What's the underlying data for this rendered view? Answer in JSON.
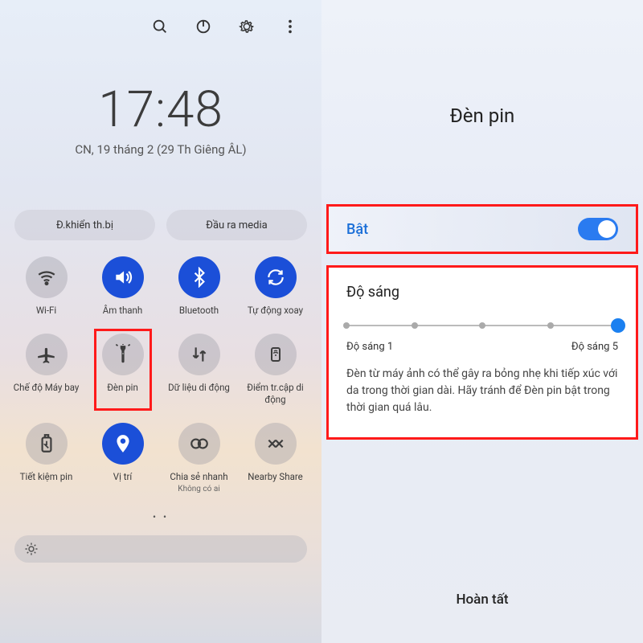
{
  "left": {
    "time": "17:48",
    "date": "CN, 19 tháng 2 (29 Th Giêng ÂL)",
    "chip1": "Đ.khiển th.bị",
    "chip2": "Đầu ra media",
    "tiles": [
      {
        "label": "Wi-Fi",
        "sub": "",
        "on": false,
        "icon": "wifi"
      },
      {
        "label": "Âm thanh",
        "sub": "",
        "on": true,
        "icon": "sound"
      },
      {
        "label": "Bluetooth",
        "sub": "",
        "on": true,
        "icon": "bluetooth"
      },
      {
        "label": "Tự động xoay",
        "sub": "",
        "on": true,
        "icon": "rotate"
      },
      {
        "label": "Chế độ Máy bay",
        "sub": "",
        "on": false,
        "icon": "airplane"
      },
      {
        "label": "Đèn pin",
        "sub": "",
        "on": false,
        "icon": "flashlight",
        "highlight": true
      },
      {
        "label": "Dữ liệu di động",
        "sub": "",
        "on": false,
        "icon": "data"
      },
      {
        "label": "Điểm tr.cập di động",
        "sub": "",
        "on": false,
        "icon": "hotspot"
      },
      {
        "label": "Tiết kiệm pin",
        "sub": "",
        "on": false,
        "icon": "battery"
      },
      {
        "label": "Vị trí",
        "sub": "",
        "on": true,
        "icon": "location"
      },
      {
        "label": "Chia sẻ nhanh",
        "sub": "Không có ai",
        "on": false,
        "icon": "quickshare"
      },
      {
        "label": "Nearby Share",
        "sub": "",
        "on": false,
        "icon": "nearby"
      }
    ],
    "pager": "• •"
  },
  "right": {
    "title": "Đèn pin",
    "toggle_label": "Bật",
    "toggle_on": true,
    "brightness_heading": "Độ sáng",
    "slider_min_label": "Độ sáng 1",
    "slider_max_label": "Độ sáng 5",
    "slider_steps": 5,
    "slider_value": 5,
    "warning": "Đèn từ máy ảnh có thể gây ra bỏng nhẹ khi tiếp xúc với da trong thời gian dài. Hãy tránh để Đèn pin bật trong thời gian quá lâu.",
    "done": "Hoàn tất"
  }
}
